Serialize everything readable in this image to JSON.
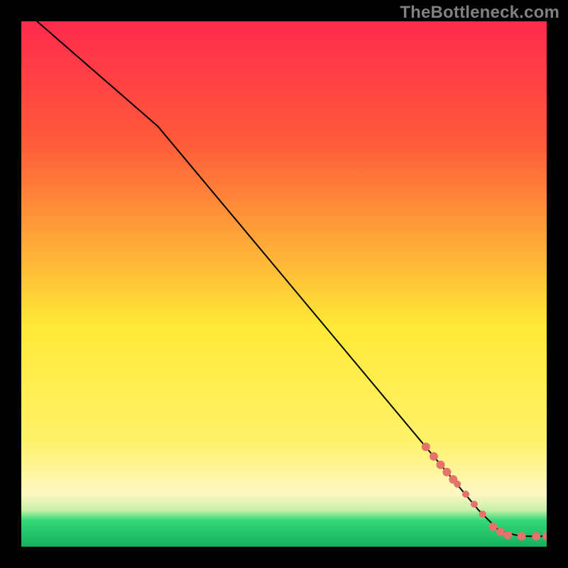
{
  "watermark": "TheBottleneck.com",
  "colors": {
    "accent_point": "#e5726b",
    "curve": "#000000",
    "frame": "#000000",
    "gradient_top": "#ff2a4d",
    "gradient_mid_upper": "#ff8a2a",
    "gradient_mid": "#ffe936",
    "gradient_lower_band": "#fdf8c4",
    "gradient_green_band": "#33d978",
    "gradient_bottom": "#13b05c"
  },
  "chart_data": {
    "type": "line",
    "title": "",
    "xlabel": "",
    "ylabel": "",
    "xlim": [
      0,
      100
    ],
    "ylim": [
      0,
      100
    ],
    "curve": {
      "name": "bottleneck-curve",
      "points": [
        {
          "x": 3,
          "y": 100
        },
        {
          "x": 26,
          "y": 80
        },
        {
          "x": 87,
          "y": 7
        },
        {
          "x": 91,
          "y": 3
        },
        {
          "x": 95,
          "y": 2
        },
        {
          "x": 100,
          "y": 2
        }
      ]
    },
    "highlight_points": {
      "name": "highlighted-range",
      "radius_large": 6,
      "radius_small": 5,
      "values": [
        {
          "x": 77.0,
          "y": 19.0,
          "r": 6
        },
        {
          "x": 78.5,
          "y": 17.2,
          "r": 6
        },
        {
          "x": 79.8,
          "y": 15.6,
          "r": 6
        },
        {
          "x": 81.0,
          "y": 14.2,
          "r": 6
        },
        {
          "x": 82.2,
          "y": 12.8,
          "r": 6
        },
        {
          "x": 83.0,
          "y": 11.9,
          "r": 5
        },
        {
          "x": 84.6,
          "y": 10.0,
          "r": 5
        },
        {
          "x": 86.2,
          "y": 8.1,
          "r": 5
        },
        {
          "x": 87.8,
          "y": 6.2,
          "r": 5
        },
        {
          "x": 89.8,
          "y": 3.8,
          "r": 6
        },
        {
          "x": 91.2,
          "y": 2.8,
          "r": 6
        },
        {
          "x": 92.6,
          "y": 2.2,
          "r": 6
        },
        {
          "x": 95.2,
          "y": 2.0,
          "r": 6
        },
        {
          "x": 98.0,
          "y": 2.0,
          "r": 6
        },
        {
          "x": 100.0,
          "y": 2.0,
          "r": 6
        }
      ]
    }
  }
}
